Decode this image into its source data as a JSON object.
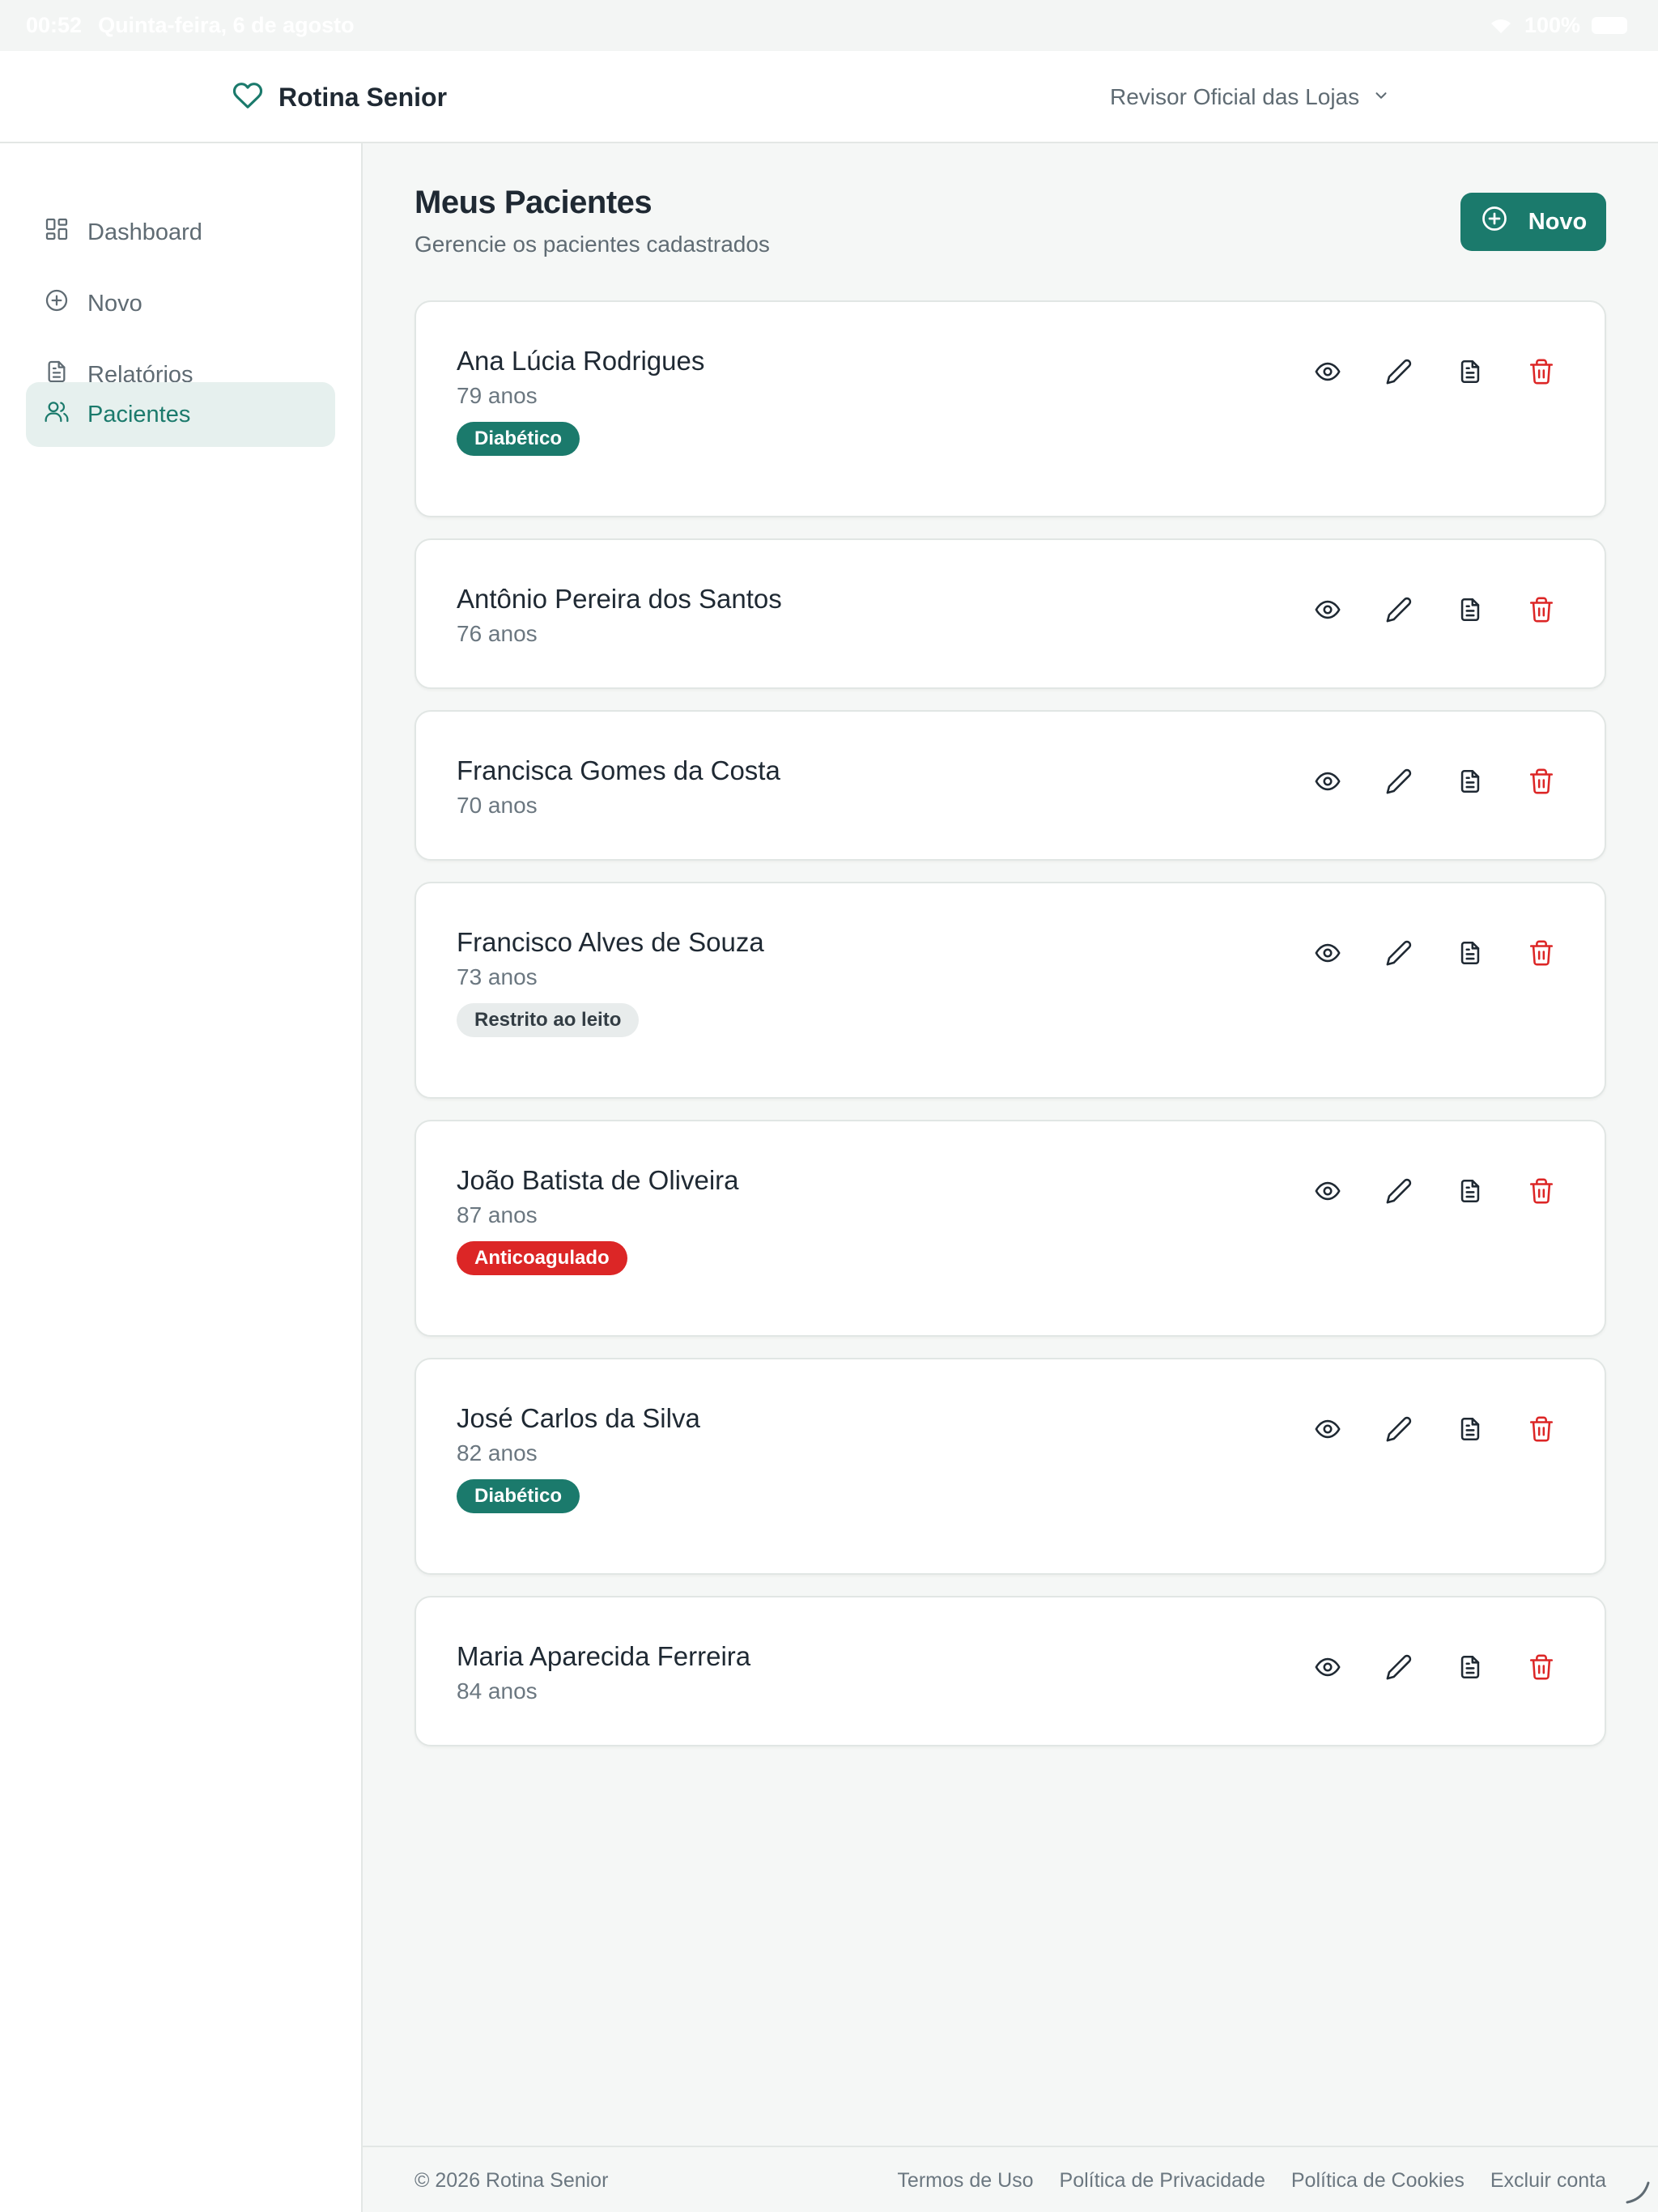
{
  "status_bar": {
    "time": "00:52",
    "date": "Quinta-feira, 6 de agosto",
    "battery": "100%"
  },
  "header": {
    "brand": "Rotina Senior",
    "user": "Revisor Oficial das Lojas"
  },
  "sidebar": {
    "items": [
      {
        "label": "Dashboard",
        "icon": "dashboard-icon",
        "active": false
      },
      {
        "label": "Novo",
        "icon": "plus-circle-icon",
        "active": false
      },
      {
        "label": "Relatórios",
        "icon": "document-icon",
        "active": false
      },
      {
        "label": "Pacientes",
        "icon": "users-icon",
        "active": true
      }
    ]
  },
  "main": {
    "title": "Meus Pacientes",
    "subtitle": "Gerencie os pacientes cadastrados",
    "new_button": "Novo"
  },
  "patients": [
    {
      "name": "Ana Lúcia Rodrigues",
      "age": "79 anos",
      "tag": "Diabético",
      "tag_style": "teal"
    },
    {
      "name": "Antônio Pereira dos Santos",
      "age": "76 anos",
      "tag": null,
      "tag_style": null
    },
    {
      "name": "Francisca Gomes da Costa",
      "age": "70 anos",
      "tag": null,
      "tag_style": null
    },
    {
      "name": "Francisco Alves de Souza",
      "age": "73 anos",
      "tag": "Restrito ao leito",
      "tag_style": "gray"
    },
    {
      "name": "João Batista de Oliveira",
      "age": "87 anos",
      "tag": "Anticoagulado",
      "tag_style": "red"
    },
    {
      "name": "José Carlos da Silva",
      "age": "82 anos",
      "tag": "Diabético",
      "tag_style": "teal"
    },
    {
      "name": "Maria Aparecida Ferreira",
      "age": "84 anos",
      "tag": null,
      "tag_style": null
    }
  ],
  "footer": {
    "copyright": "© 2026 Rotina Senior",
    "links": [
      "Termos de Uso",
      "Política de Privacidade",
      "Política de Cookies",
      "Excluir conta"
    ]
  },
  "colors": {
    "accent": "#1b7a6c",
    "danger": "#dc2626",
    "muted": "#5f6b73"
  }
}
